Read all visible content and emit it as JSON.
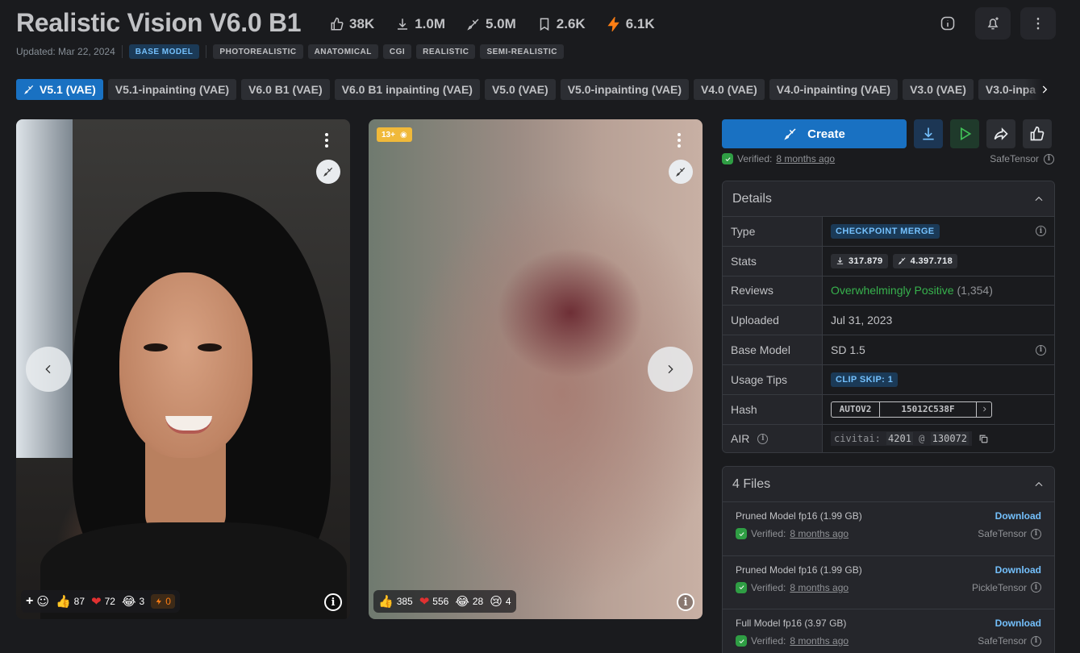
{
  "model": {
    "title": "Realistic Vision V6.0 B1",
    "updated": "Updated: Mar 22, 2024",
    "stats": {
      "likes": "38K",
      "downloads": "1.0M",
      "generations": "5.0M",
      "bookmarks": "2.6K",
      "buzz": "6.1K"
    },
    "tags": [
      "BASE MODEL",
      "PHOTOREALISTIC",
      "ANATOMICAL",
      "CGI",
      "REALISTIC",
      "SEMI-REALISTIC"
    ]
  },
  "versions": [
    "V5.1 (VAE)",
    "V5.1-inpainting (VAE)",
    "V6.0 B1 (VAE)",
    "V6.0 B1 inpainting (VAE)",
    "V5.0 (VAE)",
    "V5.0-inpainting (VAE)",
    "V4.0 (VAE)",
    "V4.0-inpainting (VAE)",
    "V3.0 (VAE)",
    "V3.0-inpa"
  ],
  "images": [
    {
      "reactions": {
        "like": "87",
        "heart": "72",
        "laugh": "3",
        "buzz": "0"
      }
    },
    {
      "nsfw_level": "13+",
      "reactions": {
        "like": "385",
        "heart": "556",
        "laugh": "28",
        "cry": "4"
      }
    }
  ],
  "actions": {
    "create_label": "Create"
  },
  "verified": {
    "label": "Verified:",
    "when": "8 months ago",
    "format": "SafeTensor"
  },
  "details": {
    "title": "Details",
    "rows": {
      "type": {
        "label": "Type",
        "value": "CHECKPOINT MERGE"
      },
      "stats": {
        "label": "Stats",
        "downloads": "317.879",
        "generations": "4.397.718"
      },
      "reviews": {
        "label": "Reviews",
        "value": "Overwhelmingly Positive",
        "count": "(1,354)"
      },
      "uploaded": {
        "label": "Uploaded",
        "value": "Jul 31, 2023"
      },
      "base_model": {
        "label": "Base Model",
        "value": "SD 1.5"
      },
      "usage_tips": {
        "label": "Usage Tips",
        "value": "CLIP SKIP: 1"
      },
      "hash": {
        "label": "Hash",
        "type": "AUTOV2",
        "value": "15012C538F"
      },
      "air": {
        "label": "AIR",
        "prefix": "civitai:",
        "model_id": "4201",
        "at": "@",
        "version_id": "130072"
      }
    }
  },
  "files": {
    "title": "4 Files",
    "items": [
      {
        "name": "Pruned Model fp16 (1.99 GB)",
        "download": "Download",
        "verified": "Verified:",
        "when": "8 months ago",
        "format": "SafeTensor"
      },
      {
        "name": "Pruned Model fp16 (1.99 GB)",
        "download": "Download",
        "verified": "Verified:",
        "when": "8 months ago",
        "format": "PickleTensor"
      },
      {
        "name": "Full Model fp16 (3.97 GB)",
        "download": "Download",
        "verified": "Verified:",
        "when": "8 months ago",
        "format": "SafeTensor"
      }
    ]
  },
  "colors": {
    "accent": "#1971c2",
    "positive": "#37b24d",
    "buzz": "#fd7e14"
  }
}
